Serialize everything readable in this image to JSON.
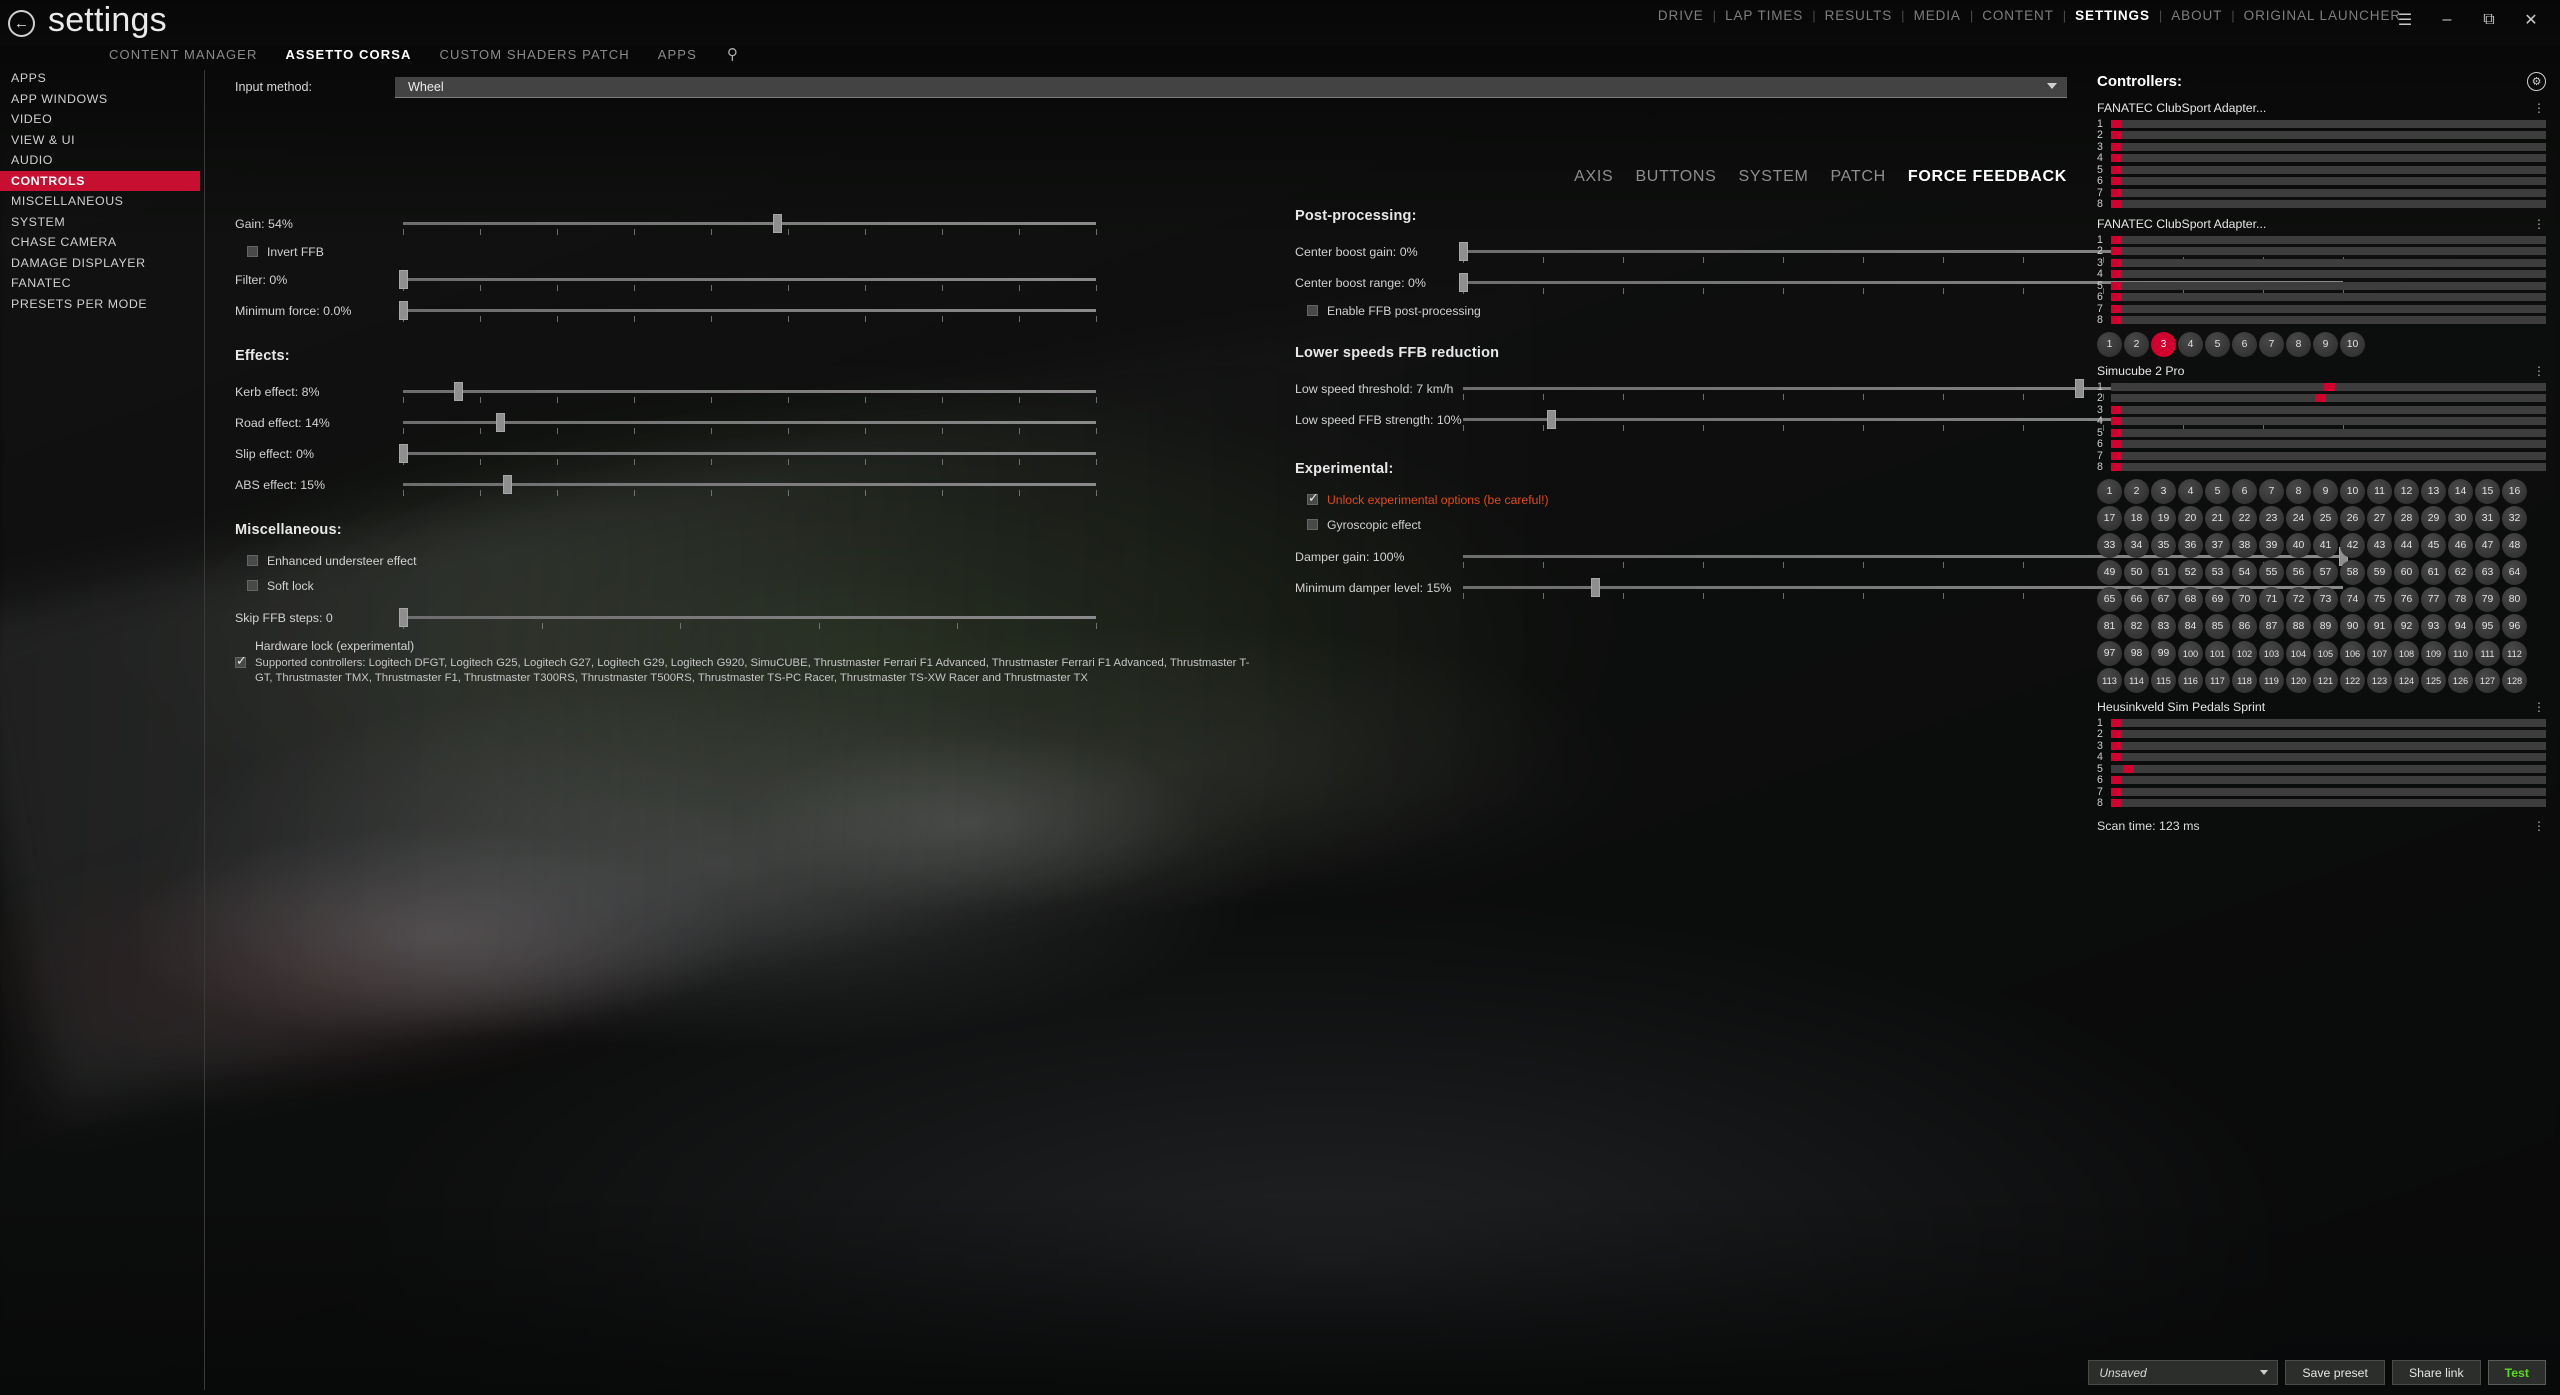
{
  "window": {
    "title": "settings",
    "back_icon": "back-arrow-icon",
    "menu_icon": "hamburger-menu-icon",
    "minimize_icon": "minimize-icon",
    "restore_icon": "restore-icon",
    "close_icon": "close-icon"
  },
  "topnav": {
    "items": [
      {
        "label": "DRIVE",
        "active": false
      },
      {
        "label": "LAP TIMES",
        "active": false
      },
      {
        "label": "RESULTS",
        "active": false
      },
      {
        "label": "MEDIA",
        "active": false
      },
      {
        "label": "CONTENT",
        "active": false
      },
      {
        "label": "SETTINGS",
        "active": true
      },
      {
        "label": "ABOUT",
        "active": false
      },
      {
        "label": "ORIGINAL LAUNCHER",
        "active": false
      }
    ],
    "separator": "|"
  },
  "subnav": {
    "items": [
      {
        "label": "CONTENT MANAGER",
        "active": false
      },
      {
        "label": "ASSETTO CORSA",
        "active": true
      },
      {
        "label": "CUSTOM SHADERS PATCH",
        "active": false
      },
      {
        "label": "APPS",
        "active": false
      }
    ],
    "search_icon": "search-icon"
  },
  "sidebar": {
    "items": [
      {
        "label": "APPS",
        "active": false
      },
      {
        "label": "APP WINDOWS",
        "active": false
      },
      {
        "label": "VIDEO",
        "active": false
      },
      {
        "label": "VIEW & UI",
        "active": false
      },
      {
        "label": "AUDIO",
        "active": false
      },
      {
        "label": "CONTROLS",
        "active": true
      },
      {
        "label": "MISCELLANEOUS",
        "active": false
      },
      {
        "label": "SYSTEM",
        "active": false
      },
      {
        "label": "CHASE CAMERA",
        "active": false
      },
      {
        "label": "DAMAGE DISPLAYER",
        "active": false
      },
      {
        "label": "FANATEC",
        "active": false
      },
      {
        "label": "PRESETS PER MODE",
        "active": false
      }
    ],
    "active_color": "#c70f31"
  },
  "main": {
    "input_method_label": "Input method:",
    "input_method_value": "Wheel",
    "tabs": [
      {
        "label": "AXIS",
        "active": false
      },
      {
        "label": "BUTTONS",
        "active": false
      },
      {
        "label": "SYSTEM",
        "active": false
      },
      {
        "label": "PATCH",
        "active": false
      },
      {
        "label": "FORCE FEEDBACK",
        "active": true
      }
    ],
    "left": {
      "gain": {
        "label": "Gain: 54%",
        "percent": 54
      },
      "invert_ffb": {
        "label": "Invert FFB",
        "checked": false
      },
      "filter": {
        "label": "Filter: 0%",
        "percent": 0
      },
      "minimum_force": {
        "label": "Minimum force: 0.0%",
        "percent": 0
      },
      "effects_title": "Effects:",
      "kerb_effect": {
        "label": "Kerb effect: 8%",
        "percent": 8
      },
      "road_effect": {
        "label": "Road effect: 14%",
        "percent": 14
      },
      "slip_effect": {
        "label": "Slip effect: 0%",
        "percent": 0
      },
      "abs_effect": {
        "label": "ABS effect: 15%",
        "percent": 15
      },
      "misc_title": "Miscellaneous:",
      "enhanced_understeer": {
        "label": "Enhanced understeer effect",
        "checked": false
      },
      "soft_lock": {
        "label": "Soft lock",
        "checked": false
      },
      "skip_ffb_steps": {
        "label": "Skip FFB steps: 0",
        "percent": 0
      },
      "hardware_lock": {
        "label": "Hardware lock (experimental)",
        "checked": true
      },
      "supported_controllers": "Supported controllers: Logitech DFGT, Logitech G25, Logitech G27, Logitech G29, Logitech G920, SimuCUBE, Thrustmaster Ferrari F1 Advanced, Thrustmaster Ferrari F1 Advanced, Thrustmaster T-GT, Thrustmaster TMX, Thrustmaster F1, Thrustmaster T300RS, Thrustmaster T500RS, Thrustmaster TS-PC Racer, Thrustmaster TS-XW Racer and Thrustmaster TX"
    },
    "right": {
      "post_title": "Post-processing:",
      "center_boost_gain": {
        "label": "Center boost gain: 0%",
        "percent": 0
      },
      "center_boost_range": {
        "label": "Center boost range: 0%",
        "percent": 0
      },
      "enable_post": {
        "label": "Enable FFB post-processing",
        "checked": false
      },
      "lower_title": "Lower speeds FFB reduction",
      "low_speed_threshold": {
        "label": "Low speed threshold: 7 km/h",
        "percent": 70
      },
      "low_speed_strength": {
        "label": "Low speed FFB strength: 10%",
        "percent": 10
      },
      "experimental_title": "Experimental:",
      "unlock_experimental": {
        "label": "Unlock experimental options (be careful!)",
        "checked": true,
        "color": "#e04a1c"
      },
      "gyroscopic": {
        "label": "Gyroscopic effect",
        "checked": false
      },
      "damper_gain": {
        "label": "Damper gain: 100%",
        "percent": 100
      },
      "minimum_damper": {
        "label": "Minimum damper level: 15%",
        "percent": 15
      }
    }
  },
  "controllers": {
    "title": "Controllers:",
    "gear_icon": "gear-icon",
    "kebab_icon": "kebab-menu-icon",
    "devices": [
      {
        "name": "FANATEC ClubSport Adapter...",
        "axes": [
          {
            "index": "1",
            "value": 2
          },
          {
            "index": "2",
            "value": 2
          },
          {
            "index": "3",
            "value": 2
          },
          {
            "index": "4",
            "value": 2
          },
          {
            "index": "5",
            "value": 2
          },
          {
            "index": "6",
            "value": 2
          },
          {
            "index": "7",
            "value": 2
          },
          {
            "index": "8",
            "value": 2
          }
        ],
        "buttons": [],
        "highlighted_button": null
      },
      {
        "name": "FANATEC ClubSport Adapter...",
        "axes": [
          {
            "index": "1",
            "value": 2
          },
          {
            "index": "2",
            "value": 2
          },
          {
            "index": "3",
            "value": 2
          },
          {
            "index": "4",
            "value": 2
          },
          {
            "index": "5",
            "value": 2
          },
          {
            "index": "6",
            "value": 2
          },
          {
            "index": "7",
            "value": 2
          },
          {
            "index": "8",
            "value": 2
          }
        ],
        "buttons": [
          "1",
          "2",
          "3",
          "4",
          "5",
          "6",
          "7",
          "8",
          "9",
          "10"
        ],
        "highlighted_button": "3"
      },
      {
        "name": "Simucube 2 Pro",
        "axes": [
          {
            "index": "1",
            "value": 50
          },
          {
            "index": "2",
            "value": 48
          },
          {
            "index": "3",
            "value": 2
          },
          {
            "index": "4",
            "value": 2
          },
          {
            "index": "5",
            "value": 2
          },
          {
            "index": "6",
            "value": 2
          },
          {
            "index": "7",
            "value": 2
          },
          {
            "index": "8",
            "value": 2
          }
        ],
        "buttons": [
          "1",
          "2",
          "3",
          "4",
          "5",
          "6",
          "7",
          "8",
          "9",
          "10",
          "11",
          "12",
          "13",
          "14",
          "15",
          "16",
          "17",
          "18",
          "19",
          "20",
          "21",
          "22",
          "23",
          "24",
          "25",
          "26",
          "27",
          "28",
          "29",
          "30",
          "31",
          "32",
          "33",
          "34",
          "35",
          "36",
          "37",
          "38",
          "39",
          "40",
          "41",
          "42",
          "43",
          "44",
          "45",
          "46",
          "47",
          "48",
          "49",
          "50",
          "51",
          "52",
          "53",
          "54",
          "55",
          "56",
          "57",
          "58",
          "59",
          "60",
          "61",
          "62",
          "63",
          "64",
          "65",
          "66",
          "67",
          "68",
          "69",
          "70",
          "71",
          "72",
          "73",
          "74",
          "75",
          "76",
          "77",
          "78",
          "79",
          "80",
          "81",
          "82",
          "83",
          "84",
          "85",
          "86",
          "87",
          "88",
          "89",
          "90",
          "91",
          "92",
          "93",
          "94",
          "95",
          "96",
          "97",
          "98",
          "99",
          "100",
          "101",
          "102",
          "103",
          "104",
          "105",
          "106",
          "107",
          "108",
          "109",
          "110",
          "111",
          "112",
          "113",
          "114",
          "115",
          "116",
          "117",
          "118",
          "119",
          "120",
          "121",
          "122",
          "123",
          "124",
          "125",
          "126",
          "127",
          "128"
        ],
        "highlighted_button": null
      },
      {
        "name": "Heusinkveld Sim Pedals Sprint",
        "axes": [
          {
            "index": "1",
            "value": 2
          },
          {
            "index": "2",
            "value": 2
          },
          {
            "index": "3",
            "value": 2
          },
          {
            "index": "4",
            "value": 2
          },
          {
            "index": "5",
            "value": 4
          },
          {
            "index": "6",
            "value": 2
          },
          {
            "index": "7",
            "value": 2
          },
          {
            "index": "8",
            "value": 3
          }
        ],
        "buttons": [],
        "highlighted_button": null
      }
    ],
    "scan_time_label": "Scan time: 123 ms",
    "axis_color": "#d1002e"
  },
  "bottombar": {
    "preset_value": "Unsaved",
    "save_preset_label": "Save preset",
    "share_link_label": "Share link",
    "test_label": "Test",
    "test_color": "#5bdb1e"
  }
}
